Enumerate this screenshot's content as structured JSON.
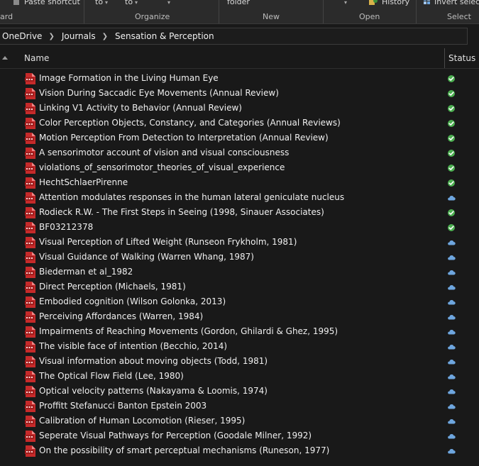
{
  "ribbon": {
    "paste_shortcut": "Paste shortcut",
    "move_to": "to",
    "copy_to": "to",
    "new_folder": "folder",
    "history": "History",
    "invert_selection": "Invert select",
    "groups": {
      "clipboard_partial": "ard",
      "organize": "Organize",
      "new": "New",
      "open": "Open",
      "select": "Select"
    }
  },
  "breadcrumb": [
    "OneDrive",
    "Journals",
    "Sensation & Perception"
  ],
  "columns": {
    "name": "Name",
    "status": "Status"
  },
  "status_colors": {
    "synced": "#4caf50",
    "cloud": "#6ea6df"
  },
  "files": [
    {
      "name": "Image Formation in the Living Human Eye",
      "status": "synced"
    },
    {
      "name": "Vision During Saccadic Eye Movements (Annual Review)",
      "status": "synced"
    },
    {
      "name": "Linking V1 Activity to Behavior (Annual Review)",
      "status": "synced"
    },
    {
      "name": "Color Perception Objects, Constancy, and Categories (Annual Reviews)",
      "status": "synced"
    },
    {
      "name": "Motion Perception From Detection to Interpretation (Annual Review)",
      "status": "synced"
    },
    {
      "name": "A sensorimotor account of vision and visual consciousness",
      "status": "synced"
    },
    {
      "name": "violations_of_sensorimotor_theories_of_visual_experience",
      "status": "synced"
    },
    {
      "name": "HechtSchlaerPirenne",
      "status": "synced"
    },
    {
      "name": "Attention modulates responses in the human lateral geniculate nucleus",
      "status": "cloud"
    },
    {
      "name": "Rodieck R.W. - The First Steps in Seeing (1998, Sinauer Associates)",
      "status": "synced"
    },
    {
      "name": "BF03212378",
      "status": "synced"
    },
    {
      "name": "Visual Perception of Lifted Weight (Runseon Frykholm, 1981)",
      "status": "cloud"
    },
    {
      "name": "Visual Guidance of Walking (Warren Whang, 1987)",
      "status": "cloud"
    },
    {
      "name": "Biederman et al_1982",
      "status": "cloud"
    },
    {
      "name": "Direct Perception (Michaels, 1981)",
      "status": "cloud"
    },
    {
      "name": "Embodied cognition (Wilson Golonka, 2013)",
      "status": "cloud"
    },
    {
      "name": "Perceiving Affordances (Warren, 1984)",
      "status": "cloud"
    },
    {
      "name": "Impairments of Reaching Movements (Gordon, Ghilardi & Ghez, 1995)",
      "status": "cloud"
    },
    {
      "name": "The visible face of intention (Becchio, 2014)",
      "status": "cloud"
    },
    {
      "name": "Visual information about moving objects (Todd, 1981)",
      "status": "cloud"
    },
    {
      "name": "The Optical Flow Field (Lee, 1980)",
      "status": "cloud"
    },
    {
      "name": "Optical velocity patterns (Nakayama & Loomis, 1974)",
      "status": "cloud"
    },
    {
      "name": "Proffitt Stefanucci Banton Epstein 2003",
      "status": "cloud"
    },
    {
      "name": "Calibration of Human Locomotion (Rieser, 1995)",
      "status": "cloud"
    },
    {
      "name": "Seperate Visual Pathways for Perception (Goodale Milner, 1992)",
      "status": "cloud"
    },
    {
      "name": "On the possibility of smart perceptual mechanisms (Runeson, 1977)",
      "status": "cloud"
    }
  ]
}
